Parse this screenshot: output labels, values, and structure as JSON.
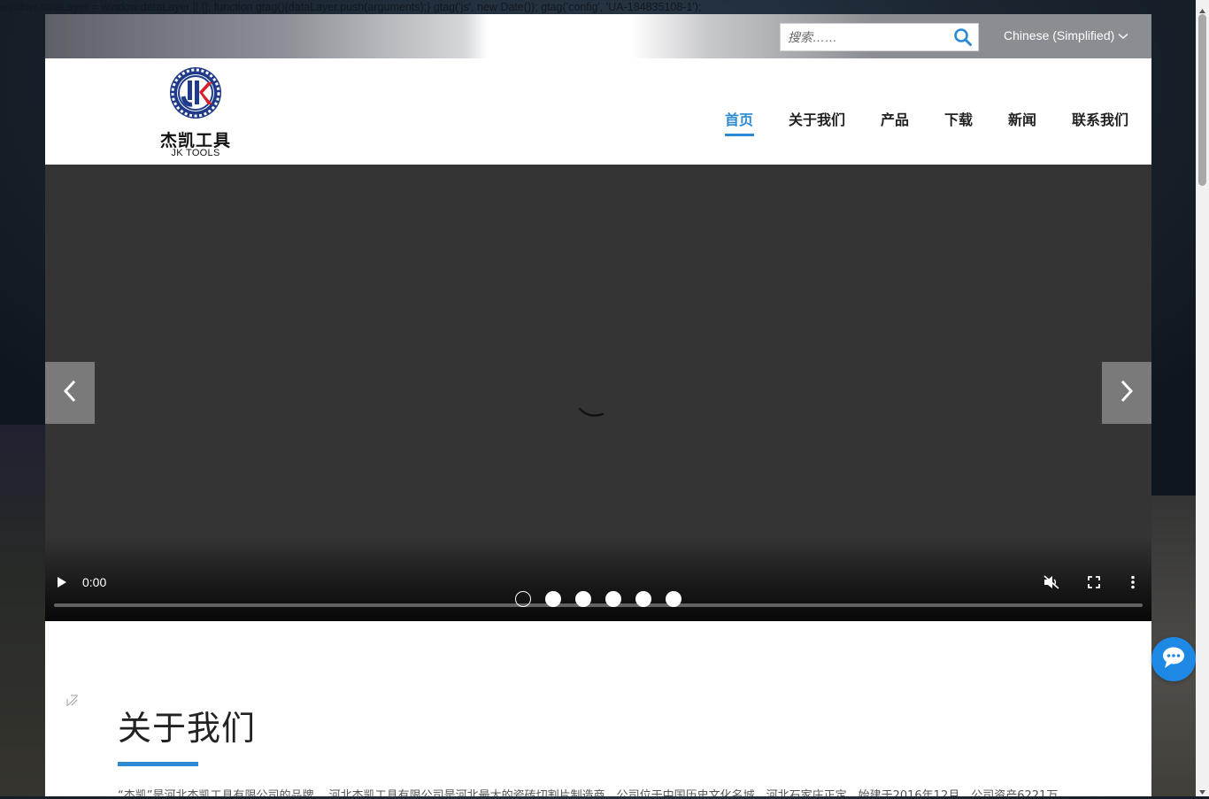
{
  "leaked_script": "window.dataLayer = window.dataLayer || []; function gtag(){dataLayer.push(arguments);} gtag('js', new Date()); gtag('config', 'UA-184835108-1');",
  "topbar": {
    "search_placeholder": "搜索……",
    "language": "Chinese (Simplified)"
  },
  "logo": {
    "cn": "杰凯工具",
    "en": "JK TOOLS"
  },
  "nav": {
    "items": [
      "首页",
      "关于我们",
      "产品",
      "下载",
      "新闻",
      "联系我们"
    ],
    "active": 0
  },
  "hero": {
    "time": "0:00",
    "slide_count": 6,
    "active_slide": 0
  },
  "about": {
    "title": "关于我们",
    "text": "“杰凯”是河北杰凯工具有限公司的品牌。 河北杰凯工具有限公司是河北最大的瓷砖切割片制造商，公司位于中国历史文化名城，河北石家庄正定，始建于2016年12月，公司资产6221万"
  },
  "colors": {
    "accent": "#2d8ad2",
    "chat": "#1e88e5",
    "hero_bg": "#343434"
  },
  "icons": {
    "search": "search-icon",
    "chevron": "chevron-down-icon",
    "chat": "chat-icon"
  }
}
